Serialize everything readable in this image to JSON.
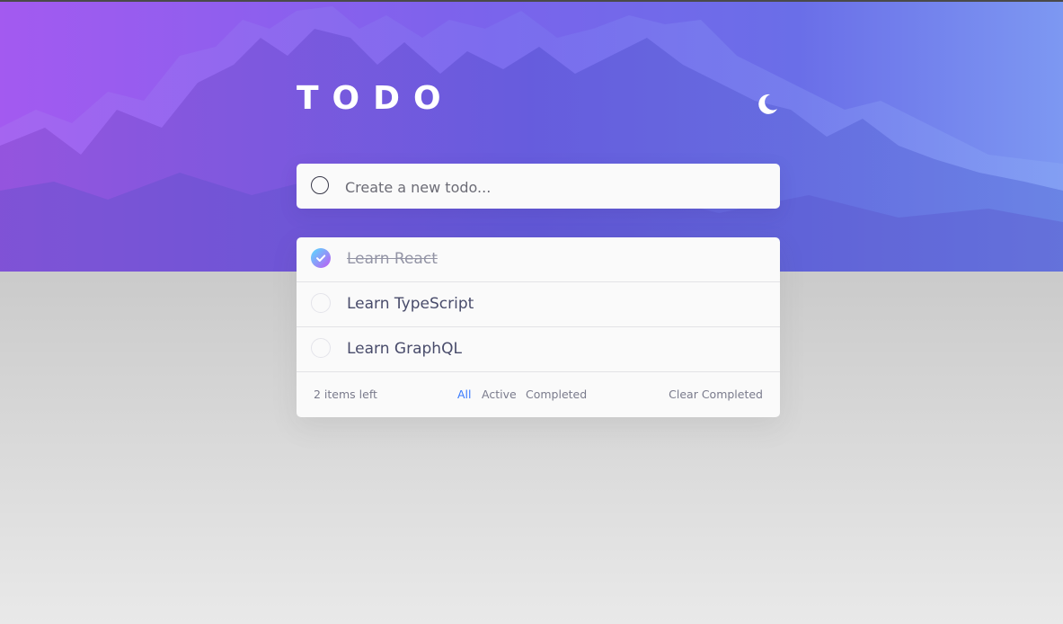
{
  "app": {
    "title": "TODO",
    "theme_icon": "moon-icon"
  },
  "new_todo": {
    "placeholder": "Create a new todo...",
    "value": ""
  },
  "todos": [
    {
      "text": "Learn React",
      "completed": true
    },
    {
      "text": "Learn TypeScript",
      "completed": false
    },
    {
      "text": "Learn GraphQL",
      "completed": false
    }
  ],
  "footer": {
    "items_left": "2 items left",
    "filters": [
      "All",
      "Active",
      "Completed"
    ],
    "active_filter": "All",
    "clear_label": "Clear Completed"
  },
  "colors": {
    "accent": "#3a7bfd",
    "check_gradient_start": "#57ddff",
    "check_gradient_end": "#c058f3",
    "hero_start": "#a35af0",
    "hero_end": "#7d98f2"
  }
}
